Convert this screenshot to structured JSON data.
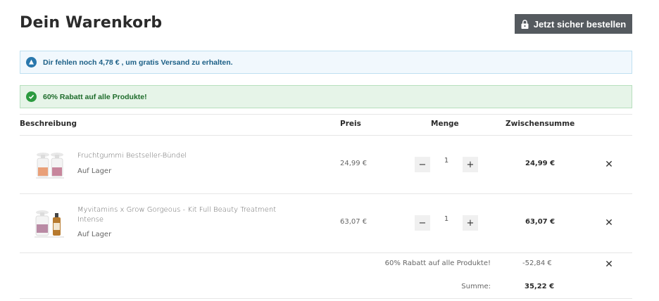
{
  "page": {
    "title": "Dein Warenkorb",
    "checkout_button": "Jetzt sicher bestellen"
  },
  "alerts": {
    "shipping": "Dir fehlen noch 4,78 € , um gratis Versand zu erhalten.",
    "discount": "60% Rabatt auf alle Produkte!"
  },
  "table": {
    "headers": {
      "description": "Beschreibung",
      "price": "Preis",
      "quantity": "Menge",
      "subtotal": "Zwischensumme"
    },
    "items": [
      {
        "name": "Fruchtgummi Bestseller-Bündel",
        "stock": "Auf Lager",
        "price": "24,99 €",
        "quantity": "1",
        "subtotal": "24,99 €"
      },
      {
        "name": "Myvitamins x Grow Gorgeous - Kit Full Beauty Treatment Intense",
        "stock": "Auf Lager",
        "price": "63,07 €",
        "quantity": "1",
        "subtotal": "63,07 €"
      }
    ]
  },
  "summary": {
    "discount_label": "60% Rabatt auf alle Produkte!",
    "discount_value": "-52,84 €",
    "total_label": "Summe:",
    "total_value": "35,22 €"
  },
  "symbols": {
    "minus": "−",
    "plus": "+",
    "remove": "✕"
  },
  "colors": {
    "checkout_button": "#555a5f",
    "info_alert": "#f1f8fd",
    "success_alert": "#e6f4e8"
  }
}
